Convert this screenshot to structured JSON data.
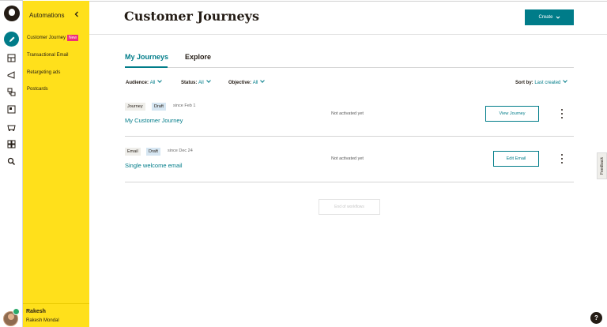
{
  "sidebar": {
    "title": "Automations",
    "items": [
      {
        "label": "Customer Journey",
        "badge": "New"
      },
      {
        "label": "Transactional Email"
      },
      {
        "label": "Retargeting ads"
      },
      {
        "label": "Postcards"
      }
    ],
    "user": {
      "name": "Rakesh",
      "full_name": "Rakesh Mondal"
    }
  },
  "rail": {
    "icons": [
      "mailchimp-logo",
      "pencil-icon",
      "audience-icon",
      "campaign-icon",
      "automation-icon",
      "content-icon",
      "store-icon",
      "integrations-icon",
      "search-icon"
    ]
  },
  "header": {
    "title": "Customer Journeys",
    "create_label": "Create"
  },
  "tabs": [
    {
      "label": "My Journeys",
      "active": true
    },
    {
      "label": "Explore",
      "active": false
    }
  ],
  "filters": {
    "audience": {
      "label": "Audience:",
      "value": "All"
    },
    "status": {
      "label": "Status:",
      "value": "All"
    },
    "objective": {
      "label": "Objective:",
      "value": "All"
    },
    "sort": {
      "label": "Sort by:",
      "value": "Last created"
    }
  },
  "rows": [
    {
      "type": "Journey",
      "state": "Draft",
      "since": "since Feb 1",
      "name": "My Customer Journey",
      "status": "Not activated yet",
      "action": "View Journey"
    },
    {
      "type": "Email",
      "state": "Draft",
      "since": "since Dec 24",
      "name": "Single welcome email",
      "status": "Not activated yet",
      "action": "Edit Email"
    }
  ],
  "end_label": "End of workflows",
  "feedback_label": "Feedback",
  "help_label": "?",
  "colors": {
    "accent": "#007c89",
    "sidebar": "#ffe01b",
    "new_badge": "#ee2f7a",
    "text": "#241c15"
  }
}
